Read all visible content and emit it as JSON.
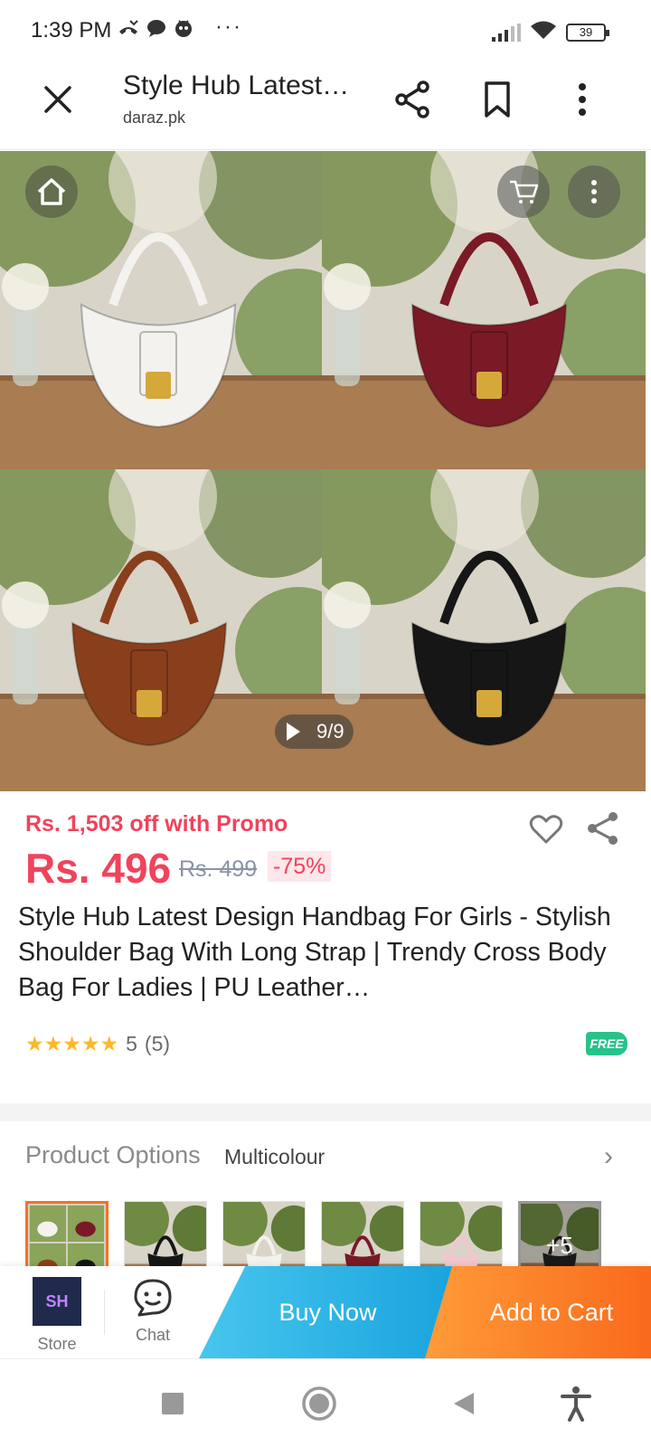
{
  "status_bar": {
    "time": "1:39 PM",
    "dots": "···",
    "battery": "39",
    "icons": [
      "missed-call-icon",
      "chat-bubble-icon",
      "app-notification-icon",
      "signal-icon",
      "wifi-icon",
      "battery-icon"
    ]
  },
  "browser": {
    "title": "Style Hub Latest…",
    "domain": "daraz.pk",
    "icons": [
      "close-icon",
      "share-icon",
      "bookmark-icon",
      "more-vertical-icon"
    ]
  },
  "gallery": {
    "counter": "9/9",
    "bag_colors": [
      "#f4f2ee",
      "#7a1a26",
      "#8a3f1c",
      "#161616"
    ]
  },
  "product": {
    "promo": "Rs. 1,503 off with Promo",
    "price": "Rs. 496",
    "old_price": "Rs. 499",
    "discount": "-75%",
    "title": "Style Hub Latest Design Handbag For Girls - Stylish Shoulder Bag With Long Strap | Trendy Cross Body Bag For Ladies | PU Leather…",
    "stars": "★★★★★",
    "rating": "5",
    "reviews": "(5)",
    "free_badge": "FREE"
  },
  "options": {
    "label": "Product Options",
    "value": "Multicolour",
    "more": "+5",
    "thumb_colors": [
      "multi",
      "#161616",
      "#f4f2ee",
      "#7a1a26",
      "#f3c6cf",
      "#222222"
    ]
  },
  "actions": {
    "store": "Store",
    "store_logo": "SH",
    "chat": "Chat",
    "buy_now": "Buy Now",
    "add_to_cart": "Add to Cart"
  },
  "colors": {
    "accent_red": "#f0435c",
    "buy_blue": "#1aa3dd",
    "cart_orange": "#f96a1c",
    "free_green": "#28c28a"
  }
}
